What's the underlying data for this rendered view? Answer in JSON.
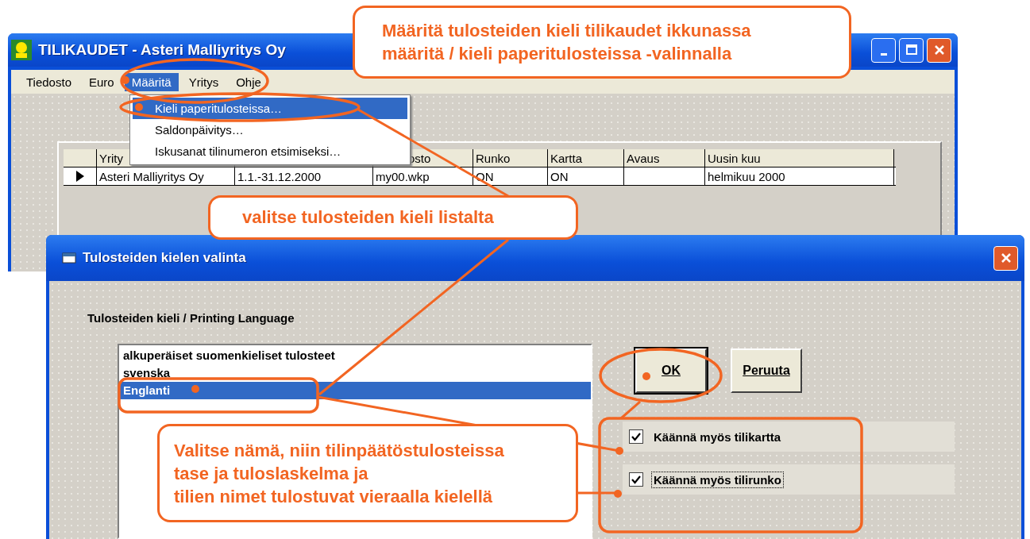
{
  "main_window": {
    "title": "TILIKAUDET - Asteri Malliyritys Oy",
    "menu": [
      {
        "label": "Tiedosto",
        "selected": false
      },
      {
        "label": "Euro",
        "selected": false
      },
      {
        "label": "Määritä",
        "selected": true
      },
      {
        "label": "Yritys",
        "selected": false
      },
      {
        "label": "Ohje",
        "selected": false
      }
    ],
    "dropdown": [
      {
        "label": "Kieli paperitulosteissa…",
        "selected": true
      },
      {
        "label": "Saldonpäivitys…",
        "selected": false
      },
      {
        "label": "Iskusanat tilinumeron etsimiseksi…",
        "selected": false
      }
    ],
    "table": {
      "columns": [
        {
          "label": "Yrity"
        },
        {},
        {
          "label": "osto"
        },
        {
          "label": "Runko"
        },
        {
          "label": "Kartta"
        },
        {
          "label": "Avaus"
        },
        {
          "label": "Uusin kuu"
        }
      ],
      "rows": [
        {
          "current": true,
          "cells": [
            "Asteri Malliyritys Oy",
            "1.1.-31.12.2000",
            "my00.wkp",
            "ON",
            "ON",
            null,
            "helmikuu 2000"
          ]
        }
      ]
    }
  },
  "dialog": {
    "title": "Tulosteiden kielen valinta",
    "list_label": "Tulosteiden kieli / Printing Language",
    "languages": [
      {
        "label": "alkuperäiset suomenkieliset tulosteet",
        "selected": false
      },
      {
        "label": "svenska",
        "selected": false
      },
      {
        "label": "Englanti",
        "selected": true
      }
    ],
    "buttons": [
      {
        "label": "OK",
        "default": true
      },
      {
        "label": "Peruuta",
        "default": false
      }
    ],
    "checkboxes": [
      {
        "label": "Käännä myös tilikartta",
        "checked": true,
        "focused": false
      },
      {
        "label": "Käännä myös tilirunko",
        "checked": true,
        "focused": true
      }
    ]
  },
  "annotations": [
    {
      "lines": [
        "Määritä tulosteiden kieli tilikaudet ikkunassa",
        "määritä / kieli paperitulosteissa -valinnalla"
      ]
    },
    {
      "lines": [
        "valitse tulosteiden kieli listalta"
      ]
    },
    {
      "lines": [
        "Valitse nämä, niin tilinpäätöstulosteissa",
        "tase ja tuloslaskelma ja",
        "tilien nimet tulostuvat vieraalla kielellä"
      ]
    }
  ]
}
